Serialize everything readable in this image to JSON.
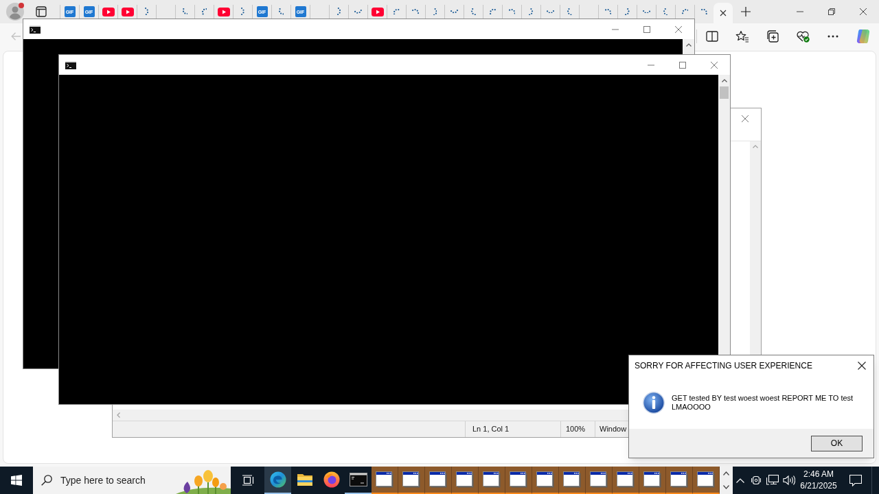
{
  "browser": {
    "profile": {
      "notification": true
    },
    "back_button": {
      "disabled": true
    },
    "tabs": [
      {
        "kind": "gif",
        "badge": "GIF",
        "selected": false
      },
      {
        "kind": "gif",
        "badge": "GIF",
        "selected": false
      },
      {
        "kind": "youtube",
        "selected": false
      },
      {
        "kind": "youtube",
        "selected": false
      },
      {
        "kind": "loading",
        "selected": false
      },
      {
        "kind": "blank",
        "selected": false
      },
      {
        "kind": "loading",
        "selected": false
      },
      {
        "kind": "loading",
        "selected": false
      },
      {
        "kind": "youtube",
        "selected": false
      },
      {
        "kind": "loading",
        "selected": false
      },
      {
        "kind": "gif",
        "badge": "GIF",
        "selected": false
      },
      {
        "kind": "loading",
        "selected": false
      },
      {
        "kind": "gif",
        "badge": "GIF",
        "selected": false
      },
      {
        "kind": "blank",
        "selected": false
      },
      {
        "kind": "loading",
        "selected": false
      },
      {
        "kind": "loading",
        "selected": false
      },
      {
        "kind": "youtube",
        "selected": false
      },
      {
        "kind": "loading",
        "selected": false
      },
      {
        "kind": "loading",
        "selected": false
      },
      {
        "kind": "loading",
        "selected": false
      },
      {
        "kind": "loading",
        "selected": false
      },
      {
        "kind": "loading",
        "selected": false
      },
      {
        "kind": "loading",
        "selected": false
      },
      {
        "kind": "loading",
        "selected": false
      },
      {
        "kind": "loading",
        "selected": false
      },
      {
        "kind": "loading",
        "selected": false
      },
      {
        "kind": "loading",
        "selected": false
      },
      {
        "kind": "blank",
        "selected": false
      },
      {
        "kind": "loading",
        "selected": false
      },
      {
        "kind": "loading",
        "selected": false
      },
      {
        "kind": "loading",
        "selected": false
      },
      {
        "kind": "loading",
        "selected": false
      },
      {
        "kind": "loading",
        "selected": false
      },
      {
        "kind": "loading",
        "selected": false
      },
      {
        "kind": "blank",
        "selected": true
      }
    ]
  },
  "notepad": {
    "status_bar": [
      {
        "text": "Ln 1, Col 1"
      },
      {
        "text": "100%"
      },
      {
        "text": "Window"
      }
    ]
  },
  "message_box": {
    "title": "SORRY FOR AFFECTING USER EXPERIENCE",
    "message": "GET tested BY test woest woest REPORT ME TO test LMAOOOO",
    "buttons": [
      {
        "label": "OK"
      }
    ]
  },
  "taskbar": {
    "search": {
      "placeholder": "Type here to search"
    },
    "pinned": [
      {
        "kind": "edge",
        "selected": true,
        "running": true
      },
      {
        "kind": "explorer",
        "selected": false,
        "running": false
      },
      {
        "kind": "firefox",
        "selected": false,
        "running": false
      },
      {
        "kind": "cmd",
        "selected": false,
        "running": true
      }
    ],
    "window_buttons": [
      {
        "flashing": true
      },
      {
        "flashing": true
      },
      {
        "flashing": true
      },
      {
        "flashing": true
      },
      {
        "flashing": true
      },
      {
        "flashing": true
      },
      {
        "flashing": true
      },
      {
        "flashing": true
      },
      {
        "flashing": true
      },
      {
        "flashing": true
      },
      {
        "flashing": true
      },
      {
        "flashing": true
      },
      {
        "flashing": true
      }
    ],
    "clock": {
      "time": "2:46 AM",
      "date": "6/21/2025"
    }
  }
}
